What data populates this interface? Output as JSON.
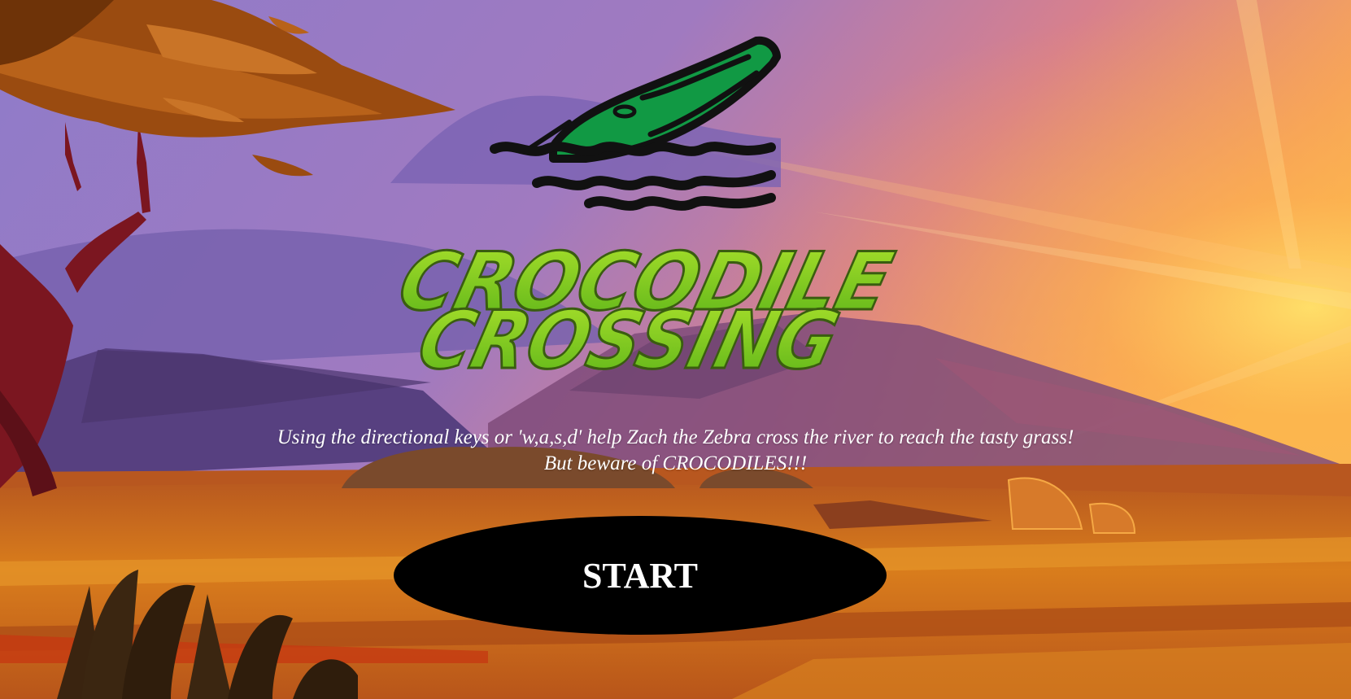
{
  "title": {
    "line1": "CROCODILE",
    "line2": "CROSSING"
  },
  "instructions": {
    "line1": "Using the directional keys or 'w,a,s,d' help Zach the Zebra cross the river to reach the tasty grass!",
    "line2": "But beware of CROCODILES!!!"
  },
  "start_button": {
    "label": "START"
  },
  "colors": {
    "title_green": "#7ed321",
    "croc_green": "#119944",
    "button_bg": "#000000",
    "sky_top": "#8a78c4",
    "sunset_orange": "#f49a52",
    "sun_yellow": "#ffe36b",
    "ground_orange": "#c9681b"
  },
  "icons": {
    "logo": "crocodile-in-water-icon"
  }
}
